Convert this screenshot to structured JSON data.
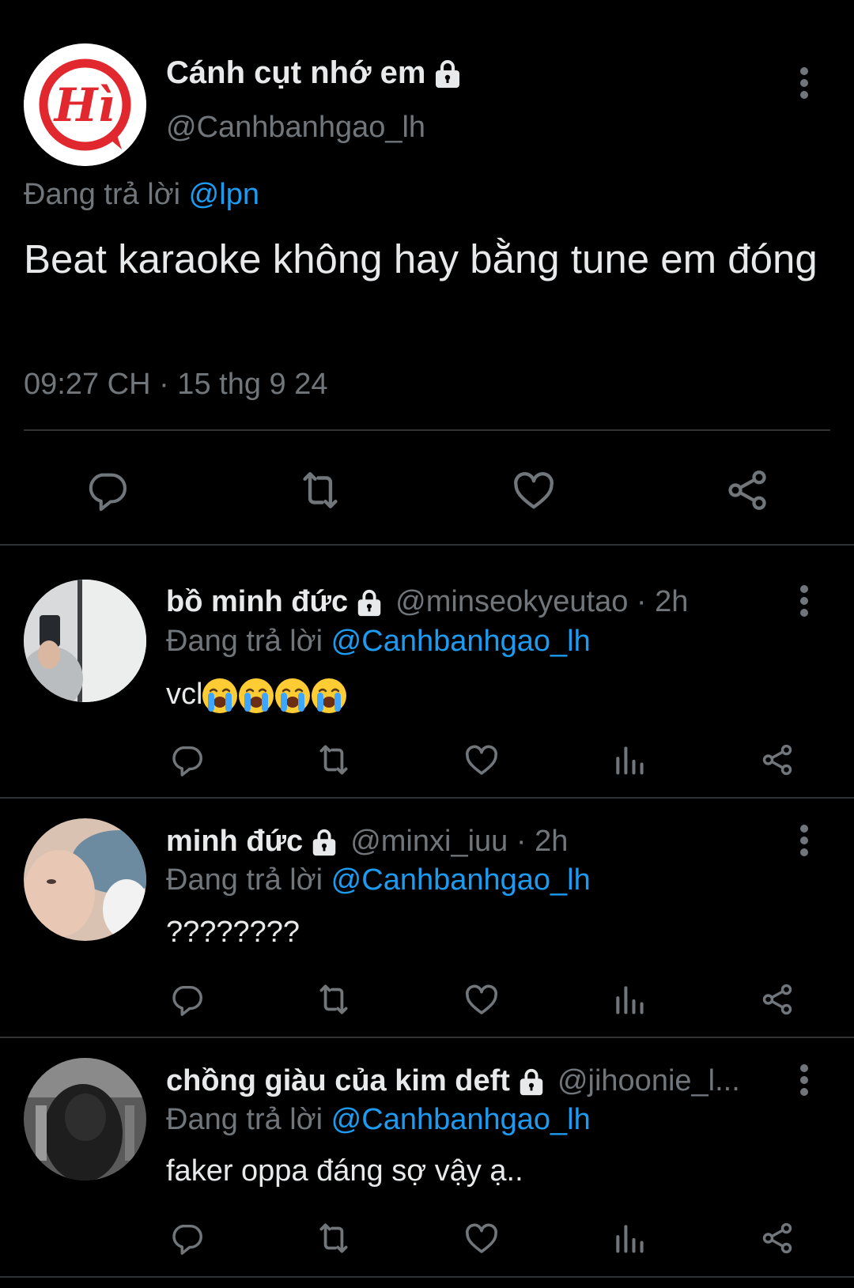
{
  "main_tweet": {
    "avatar": "hi-logo-avatar",
    "display_name": "Cánh cụt nhớ em",
    "handle": "@Canhbanhgao_lh",
    "replying_label": "Đang trả lời",
    "replying_to": "@lpn",
    "text": "Beat karaoke không hay bằng tune em đóng",
    "timestamp": "09:27 CH · 15 thg 9 24",
    "actions": [
      "reply-icon",
      "retweet-icon",
      "like-icon",
      "share-icon"
    ]
  },
  "replies": [
    {
      "display_name": "bồ minh đức",
      "handle": "@minseokyeutao · 2h",
      "replying_label": "Đang trả lời",
      "replying_to": "@Canhbanhgao_lh",
      "text": "vcl",
      "emojis": [
        "😭",
        "😭",
        "😭",
        "😭"
      ]
    },
    {
      "display_name": "minh đức",
      "handle": "@minxi_iuu · 2h",
      "replying_label": "Đang trả lời",
      "replying_to": "@Canhbanhgao_lh",
      "text": "????????"
    },
    {
      "display_name": "chồng giàu của kim deft",
      "handle": "@jihoonie_l...",
      "replying_label": "Đang trả lời",
      "replying_to": "@Canhbanhgao_lh",
      "text": "faker oppa đáng sợ vậy ạ.."
    }
  ],
  "colors": {
    "background": "#000000",
    "text": "#e7e9ea",
    "secondary": "#71767b",
    "accent": "#1d9bf0",
    "logo_red": "#e0282e"
  }
}
